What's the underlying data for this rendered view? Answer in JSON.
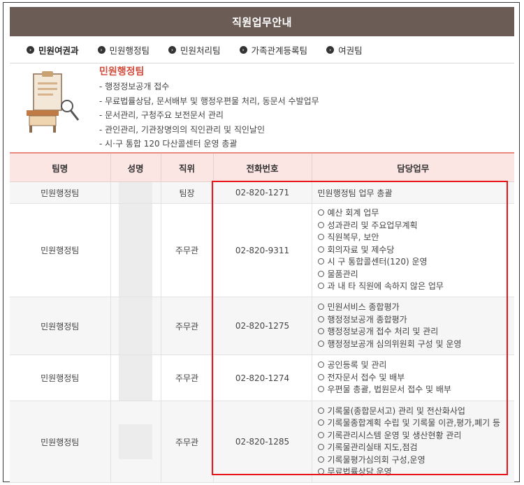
{
  "page": {
    "title": "직원업무안내"
  },
  "tabs": [
    {
      "label": "민원여권과",
      "active": true
    },
    {
      "label": "민원행정팀",
      "active": false
    },
    {
      "label": "민원처리팀",
      "active": false
    },
    {
      "label": "가족관계등록팀",
      "active": false
    },
    {
      "label": "여권팀",
      "active": false
    }
  ],
  "team": {
    "name": "민원행정팀",
    "duties": [
      "- 행정정보공개 접수",
      "- 무료법률상담, 문서배부 및 행정우편물 처리, 동문서 수발업무",
      "- 문서관리, 구청주요 보전문서 관리",
      "- 관인관리, 기관장명의의 직인관리 및 직인날인",
      "- 시·구 통합 120 다산콜센터 운영 총괄"
    ]
  },
  "table": {
    "headers": [
      "팀명",
      "성명",
      "직위",
      "전화번호",
      "담당업무"
    ],
    "rows": [
      {
        "team": "민원행정팀",
        "name": "",
        "position": "팀장",
        "phone": "02-820-1271",
        "tasks": [
          "민원행정팀 업무 총괄"
        ]
      },
      {
        "team": "민원행정팀",
        "name": "",
        "position": "주무관",
        "phone": "02-820-9311",
        "tasks": [
          "예산 회계 업무",
          "성과관리 및 주요업무계획",
          "직원복무, 보안",
          "회의자료 및 제수당",
          "시 구 통합콜센터(120) 운영",
          "물품관리",
          "과 내 타 직원에 속하지 않은 업무"
        ]
      },
      {
        "team": "민원행정팀",
        "name": "",
        "position": "주무관",
        "phone": "02-820-1275",
        "tasks": [
          "민원서비스 종합평가",
          "행정정보공개 종합평가",
          "행정정보공개 접수 처리 및 관리",
          "행정정보공개 심의위원회 구성 및 운영"
        ]
      },
      {
        "team": "민원행정팀",
        "name": "",
        "position": "주무관",
        "phone": "02-820-1274",
        "tasks": [
          "공인등록 및 관리",
          "전자문서 접수 및 배부",
          "우편물 총괄, 법원문서 접수 및 배부"
        ]
      },
      {
        "team": "민원행정팀",
        "name": "",
        "position": "주무관",
        "phone": "02-820-1285",
        "tasks": [
          "기록물(종합문서고) 관리 및 전산화사업",
          "기록물종합계획 수립 및 기록물 이관,평가,폐기 등",
          "기록관리시스템 운영 및 생산현황 관리",
          "기록물관리실태 지도,점검",
          "기록물평가심의회 구성,운영",
          "무료법률상담 운영"
        ]
      }
    ]
  },
  "colors": {
    "title_bar": "#6b5d55",
    "accent": "#d34b3a",
    "header_bg": "#fce6e4",
    "highlight_box": "#e8141a"
  },
  "icons": [
    "circle-bullet-icon",
    "document-desk-illustration"
  ]
}
